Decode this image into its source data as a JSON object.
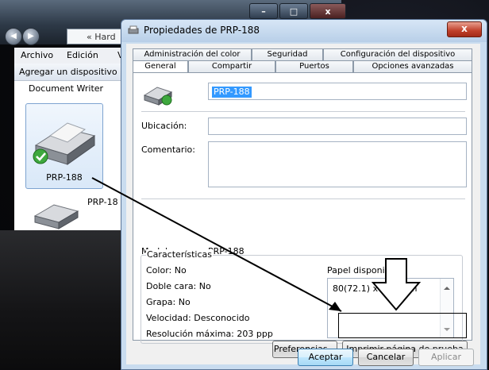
{
  "explorer": {
    "address_text": "« Hard",
    "menu": [
      "Archivo",
      "Edición",
      "V"
    ],
    "command": "Agregar un dispositivo",
    "items": {
      "document_writer": "Document Writer",
      "selected_printer": "PRP-188",
      "second_printer": "PRP-18"
    },
    "window_buttons": [
      "–",
      "□",
      "x"
    ]
  },
  "dialog": {
    "title": "Propiedades de PRP-188",
    "close_label": "x",
    "tabs_back": [
      "Administración del color",
      "Seguridad",
      "Configuración del dispositivo"
    ],
    "tabs_front": [
      "General",
      "Compartir",
      "Puertos",
      "Opciones avanzadas"
    ],
    "active_tab": "General",
    "printer_name": "PRP-188",
    "location_label": "Ubicación:",
    "location_value": "",
    "comment_label": "Comentario:",
    "comment_value": "",
    "model_label": "Modelo:",
    "model_value": "PRP-188",
    "features_title": "Características",
    "features": [
      "Color: No",
      "Doble cara: No",
      "Grapa: No",
      "Velocidad: Desconocido",
      "Resolución máxima: 203 ppp"
    ],
    "paper_title": "Papel disponible:",
    "paper_items": [
      "80(72.1) x 297 mm"
    ],
    "preferences_button": "Preferencias...",
    "test_page_button": "Imprimir página de prueba",
    "ok_button": "Aceptar",
    "cancel_button": "Cancelar",
    "apply_button": "Aplicar"
  }
}
